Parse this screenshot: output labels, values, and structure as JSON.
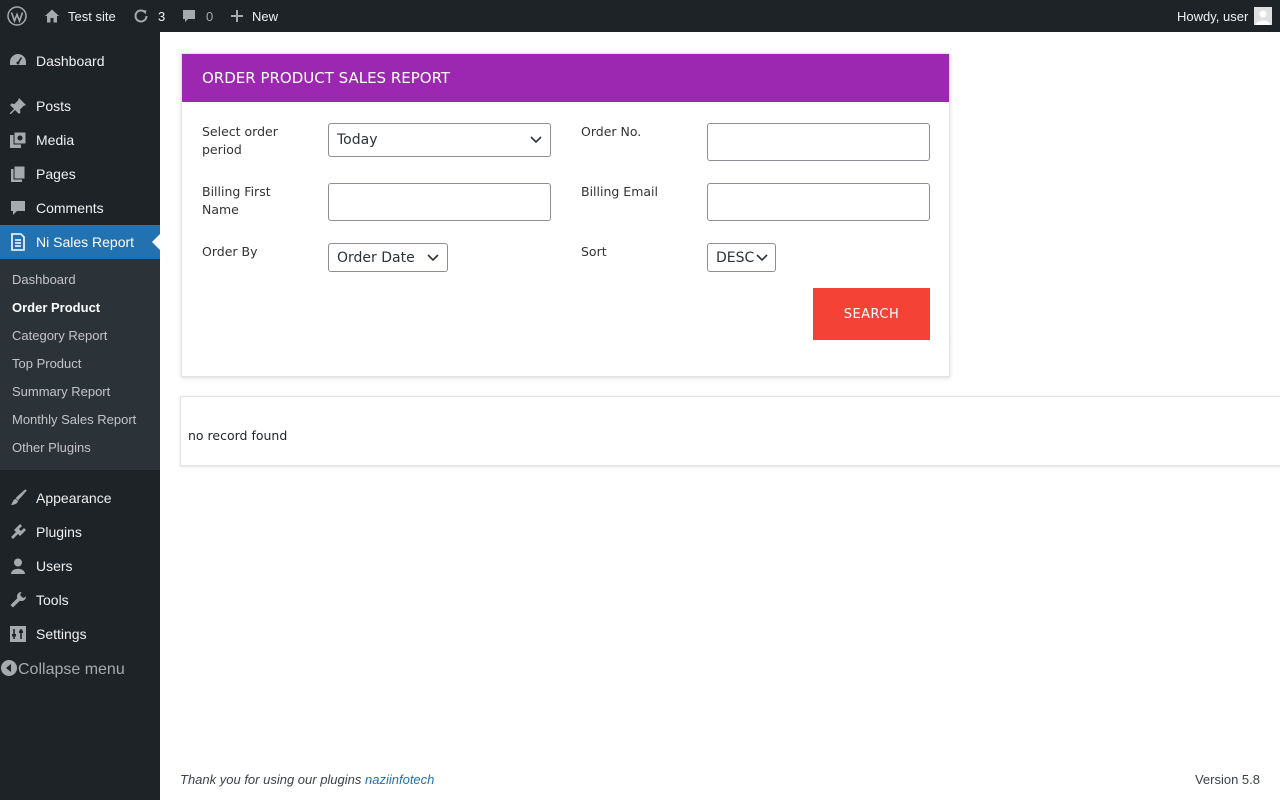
{
  "admin_bar": {
    "site_name": "Test site",
    "updates_count": "3",
    "comments_count": "0",
    "new_label": "New",
    "greeting": "Howdy, user"
  },
  "sidebar": {
    "items": [
      {
        "label": "Dashboard",
        "icon": "dashboard-icon"
      },
      {
        "label": "Posts",
        "icon": "pin-icon"
      },
      {
        "label": "Media",
        "icon": "media-icon"
      },
      {
        "label": "Pages",
        "icon": "pages-icon"
      },
      {
        "label": "Comments",
        "icon": "comment-icon"
      },
      {
        "label": "Ni Sales Report",
        "icon": "report-icon"
      },
      {
        "label": "Appearance",
        "icon": "brush-icon"
      },
      {
        "label": "Plugins",
        "icon": "plugin-icon"
      },
      {
        "label": "Users",
        "icon": "user-icon"
      },
      {
        "label": "Tools",
        "icon": "wrench-icon"
      },
      {
        "label": "Settings",
        "icon": "settings-icon"
      }
    ],
    "submenu": [
      "Dashboard",
      "Order Product",
      "Category Report",
      "Top Product",
      "Summary Report",
      "Monthly Sales Report",
      "Other Plugins"
    ],
    "collapse_label": "Collapse menu"
  },
  "report": {
    "title": "ORDER PRODUCT SALES REPORT",
    "accent_color": "#9c27b0",
    "fields": {
      "period_label": "Select order period",
      "period_value": "Today",
      "order_no_label": "Order No.",
      "order_no_value": "",
      "billing_first_name_label": "Billing First Name",
      "billing_first_name_value": "",
      "billing_email_label": "Billing Email",
      "billing_email_value": "",
      "order_by_label": "Order By",
      "order_by_value": "Order Date",
      "sort_label": "Sort",
      "sort_value": "DESC"
    },
    "search_label": "SEARCH",
    "search_color": "#f44336",
    "no_record": "no record found"
  },
  "footer": {
    "thanks_text": "Thank you for using our plugins",
    "link_text": "naziinfotech",
    "version": "Version 5.8"
  }
}
